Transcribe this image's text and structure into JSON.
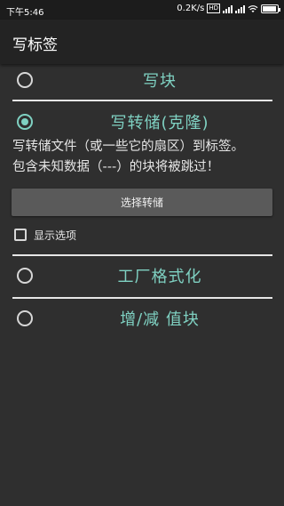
{
  "status_bar": {
    "time": "下午5:46",
    "speed": "0.2K/s",
    "network_badge": "HD",
    "icons": [
      "signal-icon",
      "signal-icon",
      "wifi-icon",
      "battery-icon"
    ]
  },
  "appbar": {
    "title": "写标签"
  },
  "options": [
    {
      "label": "写块",
      "checked": false
    },
    {
      "label": "写转储(克隆)",
      "checked": true
    },
    {
      "label": "工厂格式化",
      "checked": false
    },
    {
      "label": "增/减 值块",
      "checked": false
    }
  ],
  "clone_section": {
    "description_line1": "写转储文件（或一些它的扇区）到标签。",
    "description_line2": "包含未知数据（---）的块将被跳过！",
    "select_button_label": "选择转储",
    "show_options_label": "显示选项",
    "show_options_checked": false
  },
  "colors": {
    "accent": "#7fd1c2",
    "background": "#2f2f2f",
    "appbar": "#232323"
  }
}
